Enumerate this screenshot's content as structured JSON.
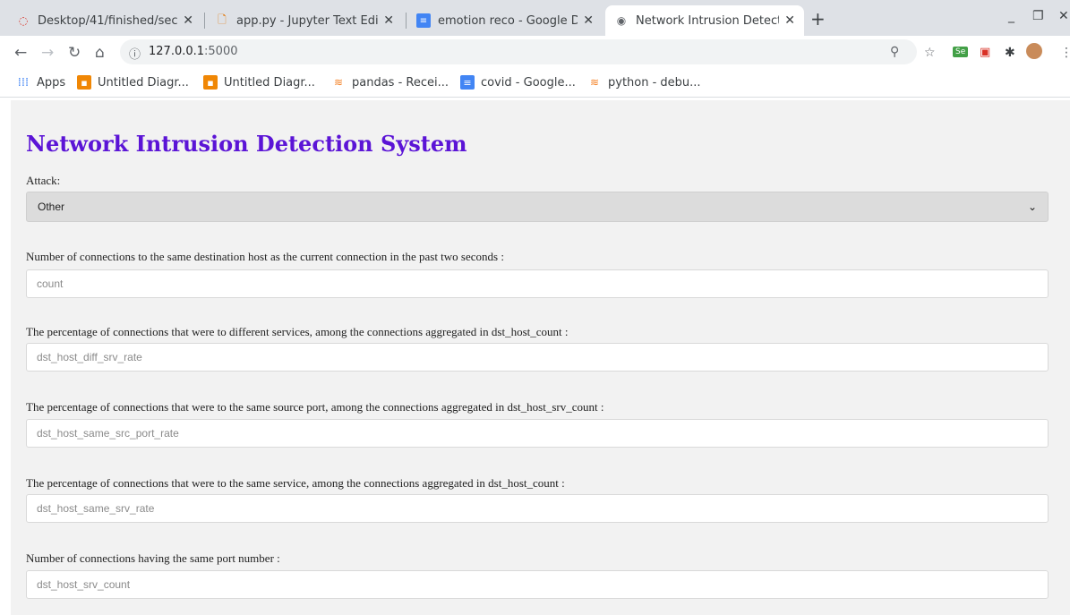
{
  "tabs": [
    {
      "title": "Desktop/41/finished/sec",
      "icon": "loading-icon"
    },
    {
      "title": "app.py - Jupyter Text Edit",
      "icon": "file-icon"
    },
    {
      "title": "emotion reco - Google Do",
      "icon": "docs-icon"
    },
    {
      "title": "Network Intrusion Detect",
      "icon": "globe-icon"
    }
  ],
  "address": {
    "host": "127.0.0.1",
    "port": ":5000"
  },
  "bookmarks": [
    {
      "label": "Apps",
      "icon": "apps-grid-icon"
    },
    {
      "label": "Untitled Diagr...",
      "icon": "drawio-icon"
    },
    {
      "label": "Untitled Diagr...",
      "icon": "drawio-icon"
    },
    {
      "label": "pandas - Recei...",
      "icon": "stackoverflow-icon"
    },
    {
      "label": "covid - Google...",
      "icon": "docs-icon"
    },
    {
      "label": "python - debu...",
      "icon": "stackoverflow-icon"
    }
  ],
  "page": {
    "title": "Network Intrusion Detection System",
    "attack_label": "Attack:",
    "attack_value": "Other",
    "fields": [
      {
        "label": "Number of connections to the same destination host as the current connection in the past two seconds :",
        "placeholder": "count"
      },
      {
        "label": "The percentage of connections that were to different services, among the connections aggregated in dst_host_count :",
        "placeholder": "dst_host_diff_srv_rate"
      },
      {
        "label": "The percentage of connections that were to the same source port, among the connections aggregated in dst_host_srv_count :",
        "placeholder": "dst_host_same_src_port_rate"
      },
      {
        "label": "The percentage of connections that were to the same service, among the connections aggregated in dst_host_count :",
        "placeholder": "dst_host_same_srv_rate"
      },
      {
        "label": "Number of connections having the same port number :",
        "placeholder": "dst_host_srv_count"
      }
    ]
  },
  "colors": {
    "heading": "#5b14d6",
    "page_bg": "#f2f2f2",
    "select_bg": "#dcdcdc"
  }
}
